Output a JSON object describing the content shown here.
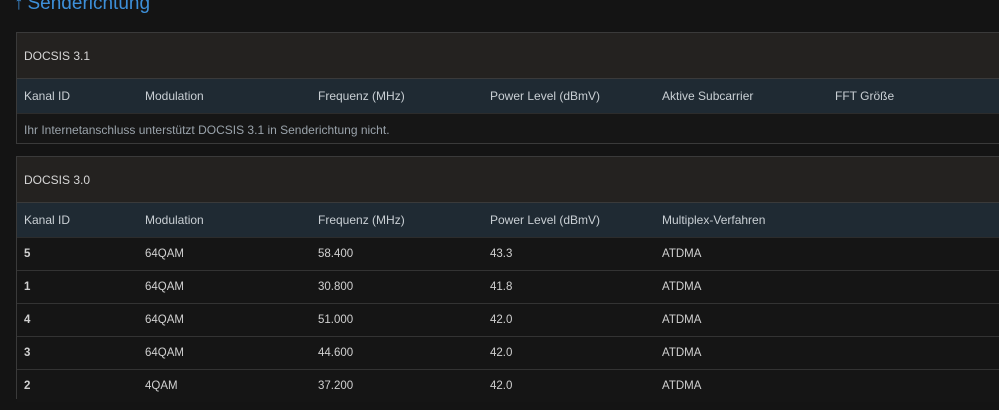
{
  "title": {
    "arrow": "↑",
    "text": "Senderichtung"
  },
  "docsis31": {
    "heading": "DOCSIS 3.1",
    "columns": [
      "Kanal ID",
      "Modulation",
      "Frequenz (MHz)",
      "Power Level (dBmV)",
      "Aktive Subcarrier",
      "FFT Größe"
    ],
    "notice": "Ihr Internetanschluss unterstützt DOCSIS 3.1 in Senderichtung nicht."
  },
  "docsis30": {
    "heading": "DOCSIS 3.0",
    "columns": [
      "Kanal ID",
      "Modulation",
      "Frequenz (MHz)",
      "Power Level (dBmV)",
      "Multiplex-Verfahren"
    ],
    "rows": [
      [
        "5",
        "64QAM",
        "58.400",
        "43.3",
        "ATDMA"
      ],
      [
        "1",
        "64QAM",
        "30.800",
        "41.8",
        "ATDMA"
      ],
      [
        "4",
        "64QAM",
        "51.000",
        "42.0",
        "ATDMA"
      ],
      [
        "3",
        "64QAM",
        "44.600",
        "42.0",
        "ATDMA"
      ],
      [
        "2",
        "4QAM",
        "37.200",
        "42.0",
        "ATDMA"
      ]
    ]
  }
}
